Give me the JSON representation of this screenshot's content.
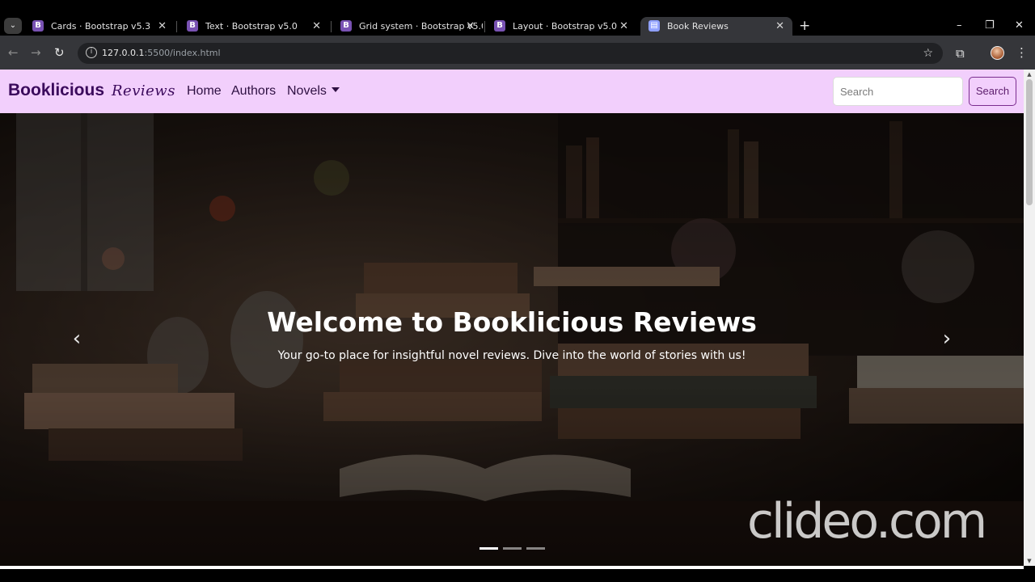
{
  "browser": {
    "tabs": [
      {
        "favicon": "B",
        "title": "Cards · Bootstrap v5.3",
        "close": "✕",
        "active": false
      },
      {
        "favicon": "B",
        "title": "Text · Bootstrap v5.0",
        "close": "✕",
        "active": false
      },
      {
        "favicon": "B",
        "title": "Grid system · Bootstrap v5.0",
        "close": "✕",
        "active": false
      },
      {
        "favicon": "B",
        "title": "Layout · Bootstrap v5.0",
        "close": "✕",
        "active": false
      },
      {
        "favicon": "▤",
        "title": "Book Reviews",
        "close": "✕",
        "active": true
      }
    ],
    "tab_menu_glyph": "⌄",
    "new_tab_glyph": "+",
    "window_controls": {
      "minimize": "–",
      "restore": "❐",
      "close": "✕"
    },
    "nav": {
      "back": "←",
      "forward": "→",
      "reload": "↻"
    },
    "url_host": "127.0.0.1",
    "url_path": ":5500/index.html",
    "bookmark_glyph": "☆",
    "extensions_glyph": "⧉",
    "menu_glyph": "⋮"
  },
  "navbar": {
    "brand": "Booklicious",
    "brand_script": "Reviews",
    "links": [
      "Home",
      "Authors",
      "Novels"
    ],
    "search_placeholder": "Search",
    "search_button": "Search",
    "bg_color": "#f2cffc"
  },
  "carousel": {
    "title": "Welcome to Booklicious Reviews",
    "subtitle": "Your go-to place for insightful novel reviews. Dive into the world of stories with us!",
    "prev_glyph": "‹",
    "next_glyph": "›",
    "slide_count": 3,
    "active_slide": 1
  },
  "watermark": "clideo.com"
}
